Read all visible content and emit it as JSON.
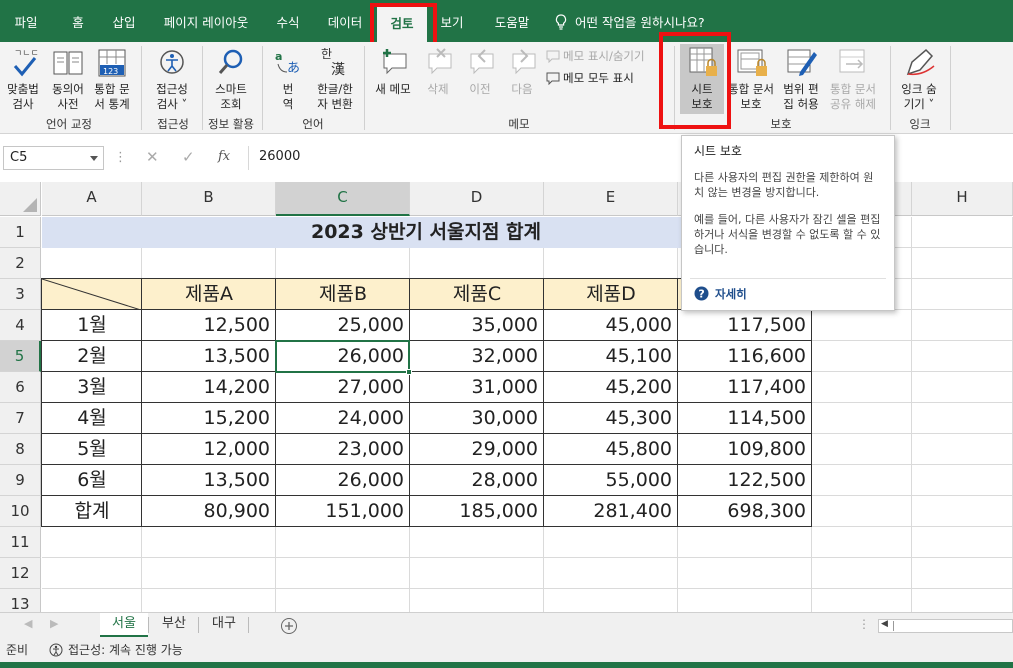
{
  "tabs": [
    "파일",
    "홈",
    "삽입",
    "페이지 레이아웃",
    "수식",
    "데이터",
    "검토",
    "보기",
    "도움말"
  ],
  "active_tab": "검토",
  "tell_me": "어떤 작업을 원하시나요?",
  "ribbon": {
    "spelling": [
      "맞춤법",
      "검사"
    ],
    "thesaurus": [
      "동의어",
      "사전"
    ],
    "workbook_stats": [
      "통합 문",
      "서 통계"
    ],
    "accessibility": [
      "접근성",
      "검사 ˅"
    ],
    "smart_lookup": [
      "스마트",
      "조회"
    ],
    "translate": [
      "번",
      "역"
    ],
    "hangul_hanja": [
      "한글/한",
      "자 변환"
    ],
    "new_comment": "새 메모",
    "delete": "삭제",
    "previous": "이전",
    "next": "다음",
    "show_hide_comment": "메모 표시/숨기기",
    "show_all_comments": "메모 모두 표시",
    "protect_sheet": [
      "시트",
      "보호"
    ],
    "protect_workbook": [
      "통합 문서",
      "보호"
    ],
    "allow_edit_ranges": [
      "범위 편",
      "집 허용"
    ],
    "unshare_workbook": [
      "통합 문서",
      "공유 해제"
    ],
    "hide_ink": [
      "잉크 숨",
      "기기 ˅"
    ],
    "groups": {
      "proofing": "언어 교정",
      "accessibility": "접근성",
      "insights": "정보 활용",
      "language": "언어",
      "comments": "메모",
      "protect": "보호",
      "ink": "잉크"
    }
  },
  "name_box": "C5",
  "formula_value": "26000",
  "fx_label": "fx",
  "columns": [
    "A",
    "B",
    "C",
    "D",
    "E",
    "F",
    "G",
    "H"
  ],
  "rows": [
    "1",
    "2",
    "3",
    "4",
    "5",
    "6",
    "7",
    "8",
    "9",
    "10",
    "11",
    "12",
    "13"
  ],
  "sheet": {
    "title": "2023 상반기 서울지점 합계",
    "headers": [
      "제품A",
      "제품B",
      "제품C",
      "제품D"
    ],
    "months": [
      "1월",
      "2월",
      "3월",
      "4월",
      "5월",
      "6월",
      "합계"
    ],
    "values": [
      [
        "12,500",
        "25,000",
        "35,000",
        "45,000",
        "117,500"
      ],
      [
        "13,500",
        "26,000",
        "32,000",
        "45,100",
        "116,600"
      ],
      [
        "14,200",
        "27,000",
        "31,000",
        "45,200",
        "117,400"
      ],
      [
        "15,200",
        "24,000",
        "30,000",
        "45,300",
        "114,500"
      ],
      [
        "12,000",
        "23,000",
        "29,000",
        "45,800",
        "109,800"
      ],
      [
        "13,500",
        "26,000",
        "28,000",
        "55,000",
        "122,500"
      ],
      [
        "80,900",
        "151,000",
        "185,000",
        "281,400",
        "698,300"
      ]
    ]
  },
  "sheet_tabs": [
    "서울",
    "부산",
    "대구"
  ],
  "active_sheet": "서울",
  "status": {
    "ready": "준비",
    "accessibility": "접근성: 계속 진행 가능"
  },
  "tooltip": {
    "title": "시트 보호",
    "p1": "다른 사용자의 편집 권한을 제한하여 원치 않는 변경을 방지합니다.",
    "p2": "예를 들어, 다른 사용자가 잠긴 셀을 편집하거나 서식을 변경할 수 없도록 할 수 있습니다.",
    "more": "자세히"
  },
  "colors": {
    "accent": "#217346",
    "highlight": "#ee1111",
    "header_fill": "#fdf0cc",
    "title_fill": "#d9e1f2"
  }
}
